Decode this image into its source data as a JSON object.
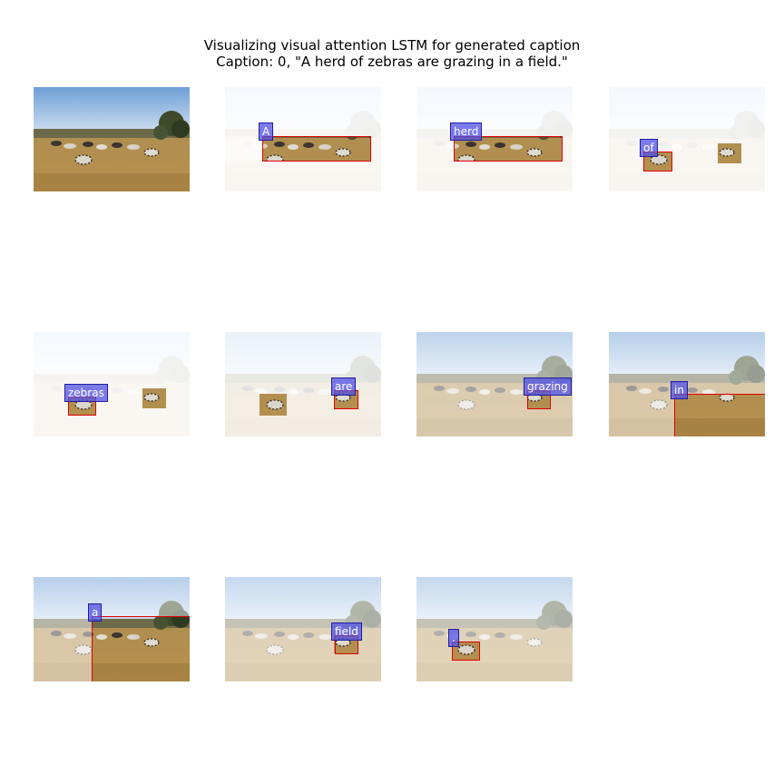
{
  "title_line1": "Visualizing visual attention LSTM for generated caption",
  "title_line2": "Caption: 0, \"A herd of zebras are grazing in a field.\"",
  "panels": [
    {
      "word": ""
    },
    {
      "word": "A"
    },
    {
      "word": "herd"
    },
    {
      "word": "of"
    },
    {
      "word": "zebras"
    },
    {
      "word": "are"
    },
    {
      "word": "grazing"
    },
    {
      "word": "in"
    },
    {
      "word": "a"
    },
    {
      "word": "field"
    },
    {
      "word": "."
    }
  ],
  "colors": {
    "word_box": "#5050e6",
    "attention_box": "#e00000"
  }
}
